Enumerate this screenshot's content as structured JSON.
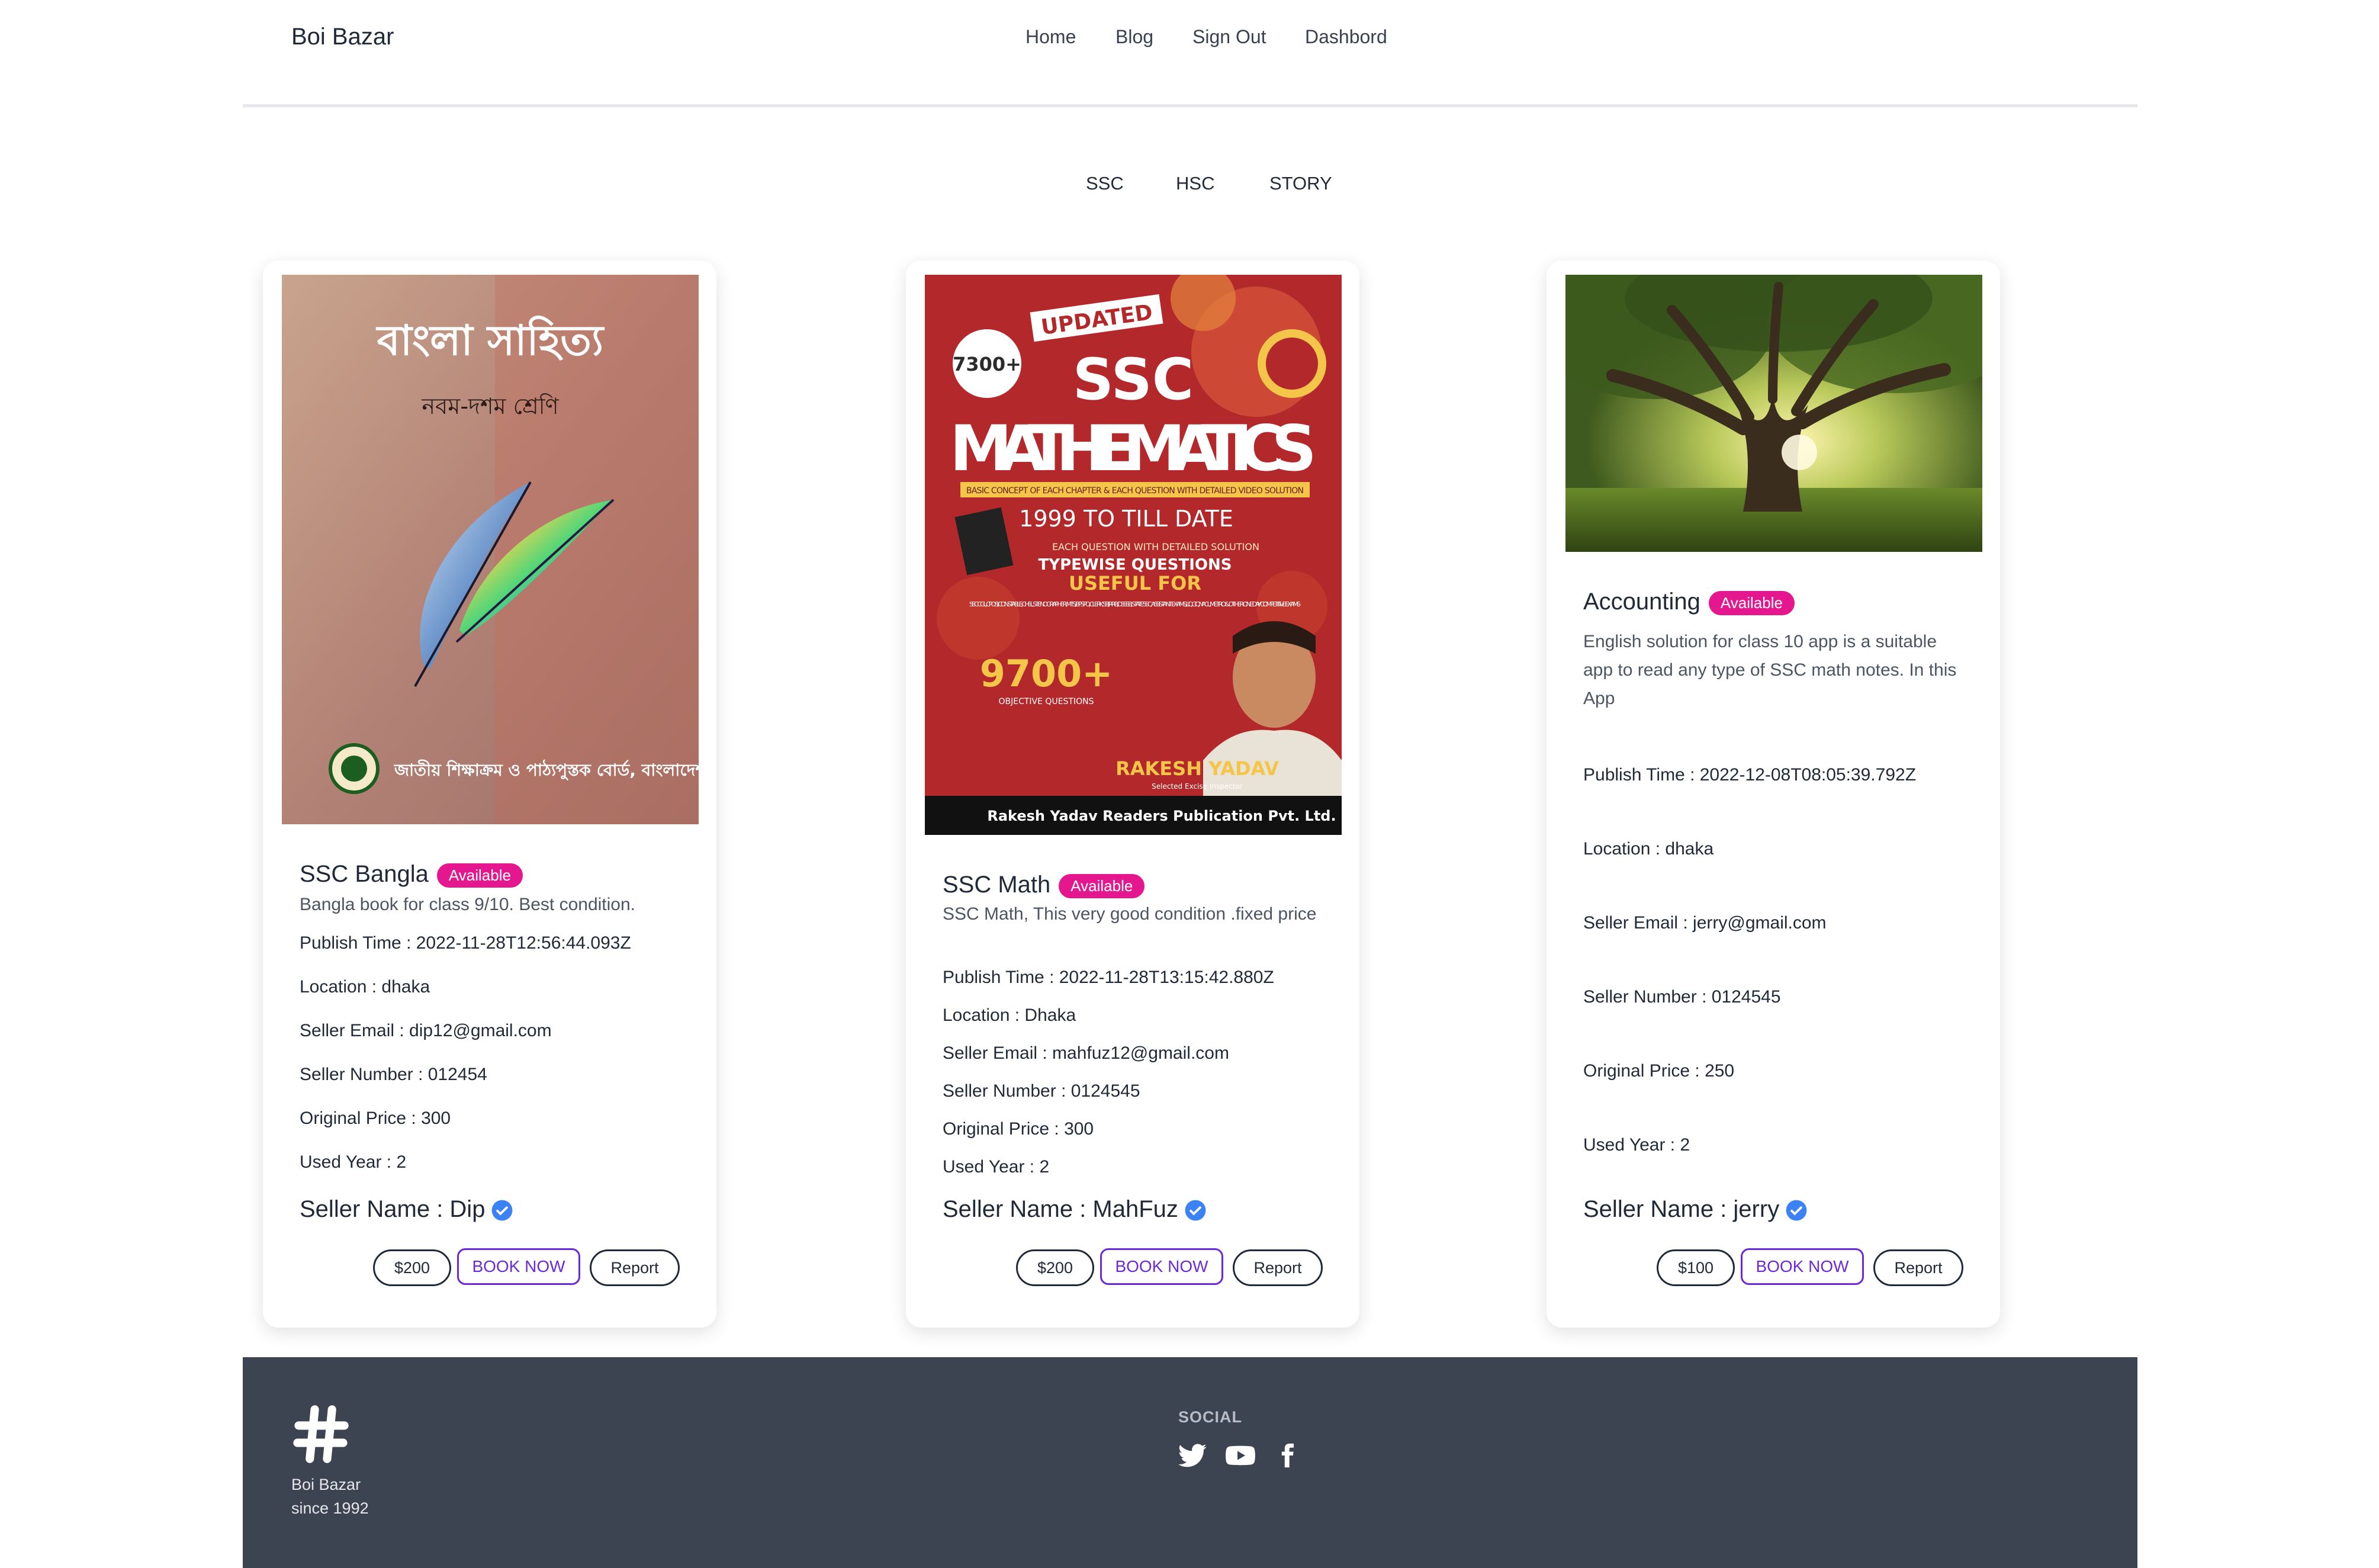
{
  "navbar": {
    "brand": "Boi Bazar",
    "links": [
      "Home",
      "Blog",
      "Sign Out",
      "Dashbord"
    ]
  },
  "tabs": [
    "SSC",
    "HSC",
    "STORY"
  ],
  "cards": [
    {
      "cover_title": "বাংলা সাহিত্য",
      "cover_subtitle": "নবম-দশম শ্রেণি",
      "cover_footer": "জাতীয় শিক্ষাক্রম ও পাঠ্যপুস্তক বোর্ড, বাংলাদেশ",
      "title": "SSC Bangla",
      "badge": "Available",
      "description": "Bangla book for class 9/10. Best condition.",
      "publish_time": "Publish Time : 2022-11-28T12:56:44.093Z",
      "location": "Location : dhaka",
      "seller_email": "Seller Email : dip12@gmail.com",
      "seller_number": "Seller Number : 012454",
      "original_price": "Original Price : 300",
      "used_year": "Used Year : 2",
      "seller_name": "Seller Name : Dip",
      "price": "$200",
      "book_label": "BOOK NOW",
      "report_label": "Report"
    },
    {
      "cover_updated": "UPDATED",
      "cover_badge_count": "7300+",
      "cover_title_1": "SSC",
      "cover_title_2": "MATHEMATICS",
      "cover_strip": "BASIC CONCEPT OF EACH CHAPTER & EACH QUESTION WITH DETAILED VIDEO SOLUTION",
      "cover_range": "1999 TO TILL DATE",
      "cover_line_1": "EACH QUESTION WITH DETAILED SOLUTION",
      "cover_line_2": "TYPEWISE QUESTIONS",
      "cover_line_3": "USEFUL FOR",
      "cover_line_4": "SSC CGL, CPO SI, CONSTABLE, CHSL, STENOGRAPHER, MTS, IBPS PO, CLERK, SBI, RRB, DSSSB, STATE SSC, ASSISTANT EXAMS, LIC, GIC, NACL, METRO & OTHER ONE DAY COMPETITIVE EXAMS",
      "cover_count": "9700+",
      "cover_count_sub": "OBJECTIVE QUESTIONS",
      "cover_author": "RAKESH YADAV",
      "cover_author_sub": "Selected Excise Inspector",
      "cover_publisher": "Rakesh Yadav Readers Publication Pvt. Ltd.",
      "title": "SSC Math",
      "badge": "Available",
      "description": "SSC Math, This very good condition .fixed price",
      "publish_time": "Publish Time : 2022-11-28T13:15:42.880Z",
      "location": "Location : Dhaka",
      "seller_email": "Seller Email : mahfuz12@gmail.com",
      "seller_number": "Seller Number : 0124545",
      "original_price": "Original Price : 300",
      "used_year": "Used Year : 2",
      "seller_name": "Seller Name : MahFuz",
      "price": "$200",
      "book_label": "BOOK NOW",
      "report_label": "Report"
    },
    {
      "title": "Accounting",
      "badge": "Available",
      "description": "English solution for class 10 app is a suitable app to read any type of SSC math notes. In this App",
      "publish_time": "Publish Time : 2022-12-08T08:05:39.792Z",
      "location": "Location : dhaka",
      "seller_email": "Seller Email : jerry@gmail.com",
      "seller_number": "Seller Number : 0124545",
      "original_price": "Original Price : 250",
      "used_year": "Used Year : 2",
      "seller_name": "Seller Name : jerry",
      "price": "$100",
      "book_label": "BOOK NOW",
      "report_label": "Report"
    }
  ],
  "footer": {
    "brand": "Boi Bazar",
    "since": "since 1992",
    "social_title": "SOCIAL",
    "social_icons": [
      "twitter-icon",
      "youtube-icon",
      "facebook-icon"
    ]
  },
  "colors": {
    "badge": "#e5178e",
    "book_button": "#6d28d9",
    "verified": "#3b82f6",
    "footer_bg": "#3d4451"
  }
}
